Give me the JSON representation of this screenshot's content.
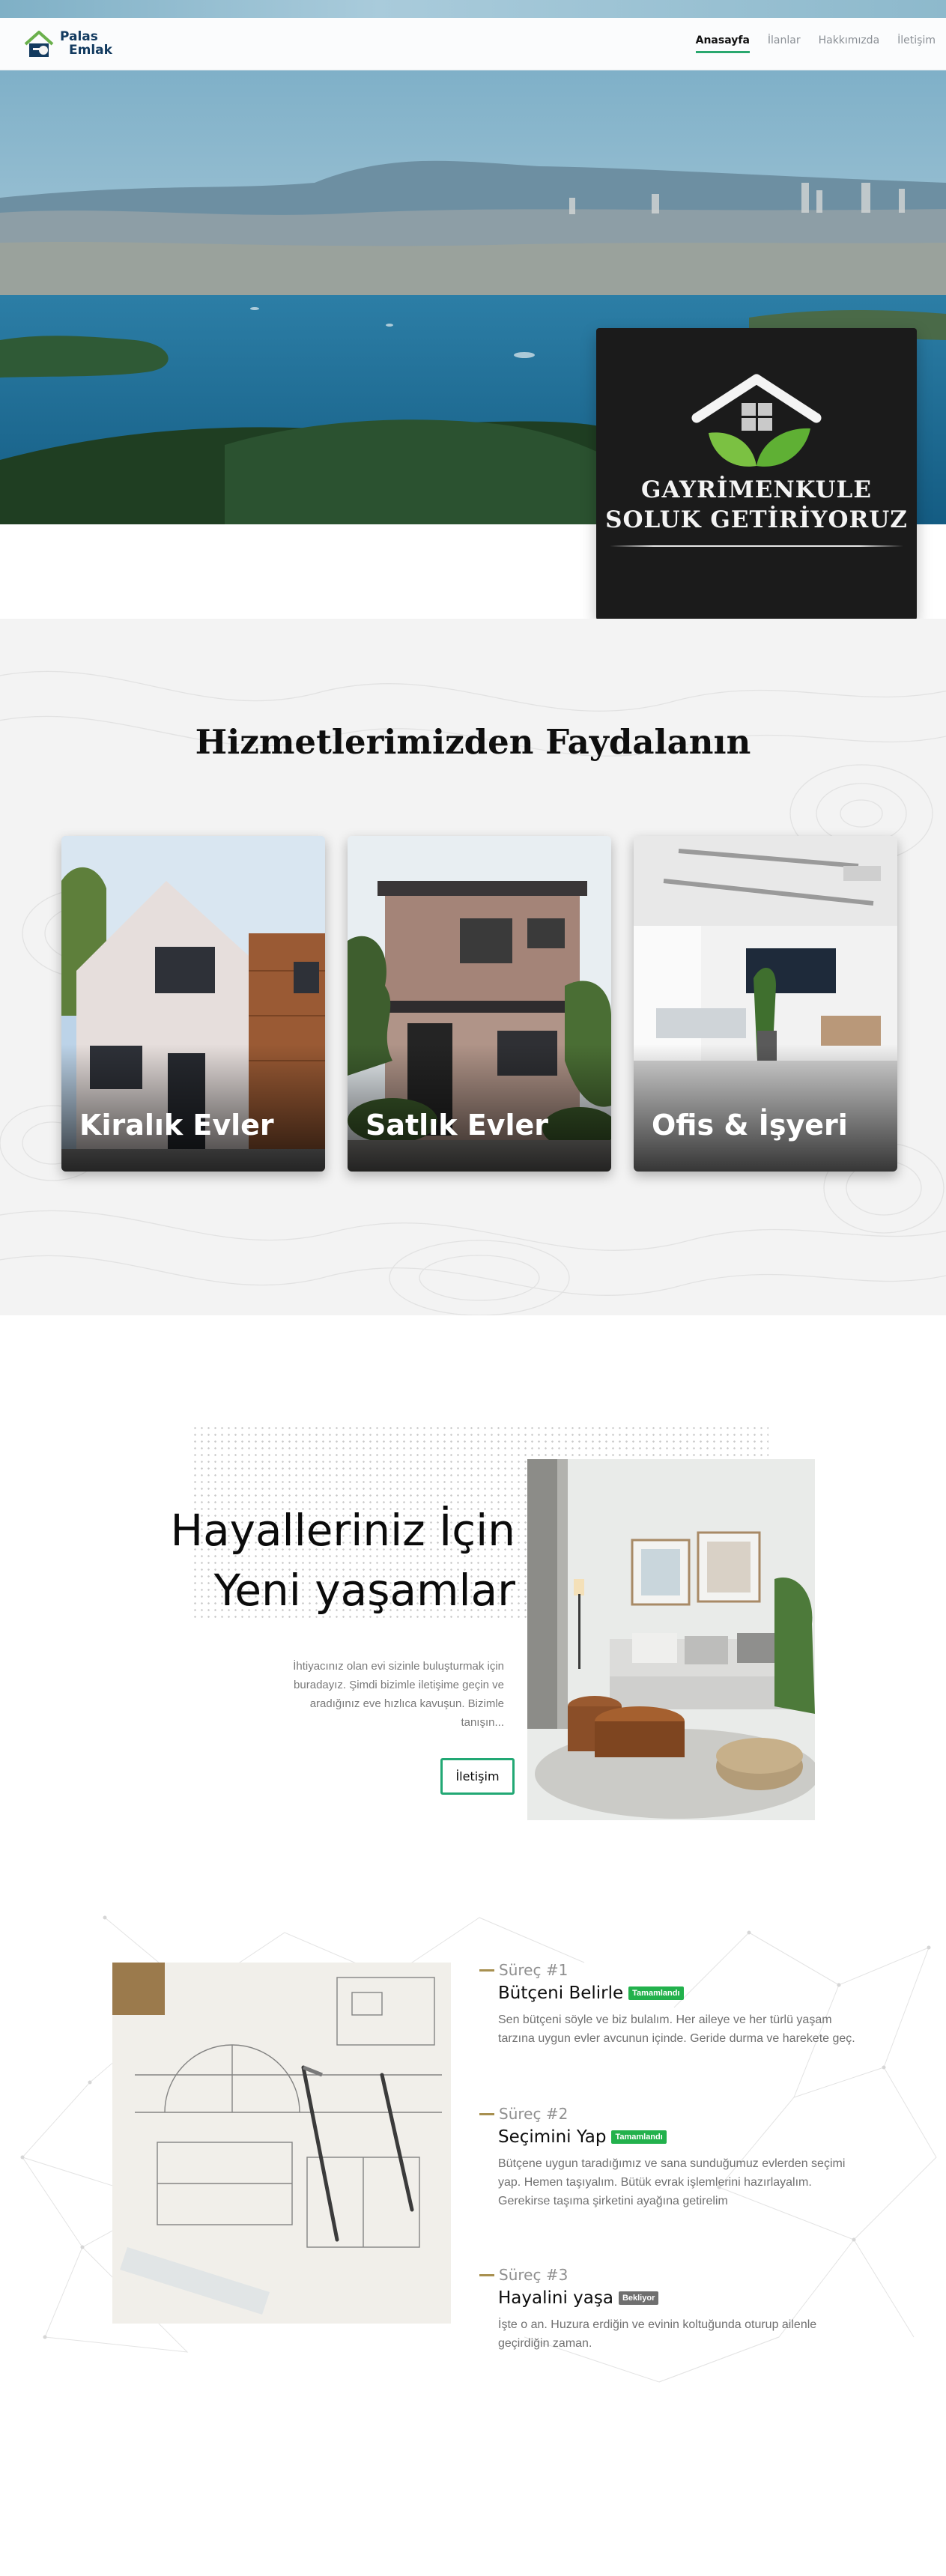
{
  "brand": {
    "line1": "Palas",
    "line2": "Emlak"
  },
  "nav": {
    "items": [
      {
        "label": "Anasayfa",
        "active": true
      },
      {
        "label": "İlanlar",
        "active": false
      },
      {
        "label": "Hakkımızda",
        "active": false
      },
      {
        "label": "İletişim",
        "active": false
      }
    ]
  },
  "hero": {
    "card_line1": "GAYRİMENKULE",
    "card_line2": "SOLUK GETİRİYORUZ"
  },
  "services": {
    "title": "Hizmetlerimizden Faydalanın",
    "cards": [
      {
        "label": "Kiralık Evler"
      },
      {
        "label": "Satlık Evler"
      },
      {
        "label": "Ofis & İşyeri"
      }
    ]
  },
  "dreams": {
    "title_line1": "Hayalleriniz İçin",
    "title_line2": "Yeni yaşamlar",
    "text": "İhtiyacınız olan evi sizinle buluşturmak için buradayız. Şimdi bizimle iletişime geçin ve aradığınız eve hızlıca kavuşun. Bizimle tanışın...",
    "button_label": "İletişim"
  },
  "process": {
    "steps": [
      {
        "number": "Süreç #1",
        "title": "Bütçeni Belirle",
        "badge": "Tamamlandı",
        "status": "done",
        "text": "Sen bütçeni söyle ve biz bulalım. Her aileye ve her türlü yaşam tarzına uygun evler avcunun içinde. Geride durma ve harekete geç."
      },
      {
        "number": "Süreç #2",
        "title": "Seçimini Yap",
        "badge": "Tamamlandı",
        "status": "done",
        "text": "Bütçene uygun taradığımız ve sana sunduğumuz evlerden seçimi yap. Hemen taşıyalım. Bütük evrak işlemlerini hazırlayalım. Gerekirse taşıma şirketini ayağına getirelim"
      },
      {
        "number": "Süreç #3",
        "title": "Hayalini yaşa",
        "badge": "Bekliyor",
        "status": "waiting",
        "text": "İşte o an. Huzura erdiğin ve evinin koltuğunda oturup ailenle geçirdiğin zaman."
      }
    ]
  },
  "colors": {
    "accent": "#22a874",
    "brand_dark": "#123a5f",
    "badge_done": "#22b14c",
    "badge_wait": "#6f6f6f"
  }
}
